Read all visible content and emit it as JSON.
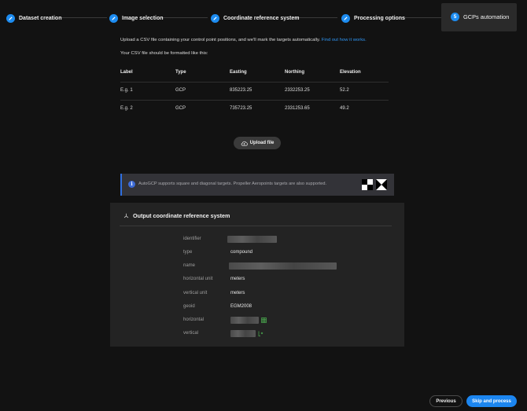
{
  "stepper": {
    "steps": [
      {
        "label": "Dataset creation",
        "icon": "pencil-icon"
      },
      {
        "label": "Image selection",
        "icon": "pencil-icon"
      },
      {
        "label": "Coordinate reference system",
        "icon": "pencil-icon"
      },
      {
        "label": "Processing options",
        "icon": "pencil-icon"
      },
      {
        "label": "GCPs automation",
        "number": "5"
      }
    ],
    "accent": "#1d8cf0"
  },
  "intro": {
    "text": "Upload a CSV file containing your control point positions, and we'll mark the targets automatically.",
    "link": "Find out how it works.",
    "format_note": "Your CSV file should be formatted like this:"
  },
  "csv_table": {
    "headers": [
      "Label",
      "Type",
      "Easting",
      "Northing",
      "Elevation"
    ],
    "rows": [
      [
        "E.g. 1",
        "GCP",
        "835223.25",
        "2332253.25",
        "52.2"
      ],
      [
        "E.g. 2",
        "GCP",
        "735723.25",
        "2331253.65",
        "49.2"
      ]
    ]
  },
  "upload": {
    "label": "Upload file"
  },
  "banner": {
    "text": "AutoGCP supports square and diagonal targets. Propeller Aeropoints targets are also supported.",
    "info_glyph": "i"
  },
  "crs_panel": {
    "title": "Output coordinate reference system",
    "rows": [
      {
        "key": "identifier",
        "value": ""
      },
      {
        "key": "type",
        "value": "compound"
      },
      {
        "key": "name",
        "value": ""
      },
      {
        "key": "horizontal unit",
        "value": "meters"
      },
      {
        "key": "vertical unit",
        "value": "meters"
      },
      {
        "key": "geoid",
        "value": "EGM2008"
      },
      {
        "key": "horizontal",
        "value": ""
      },
      {
        "key": "vertical",
        "value": ""
      }
    ]
  },
  "footer": {
    "previous": "Previous",
    "skip": "Skip and process"
  }
}
